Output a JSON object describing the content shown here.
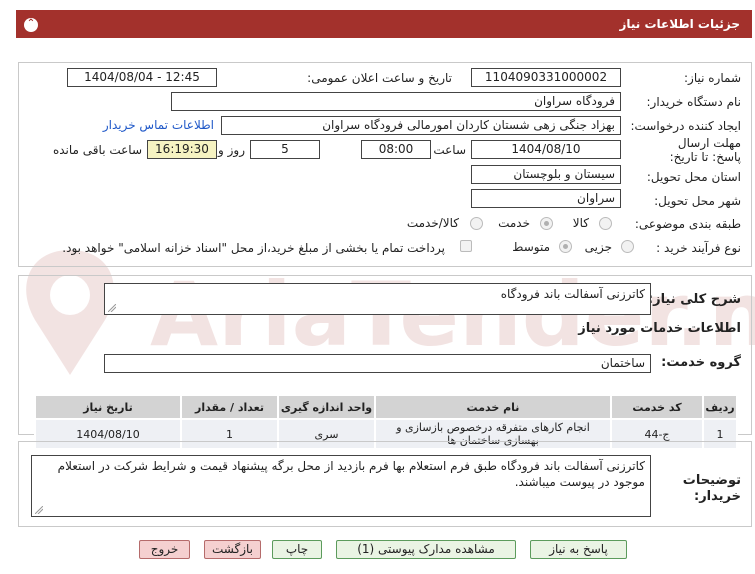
{
  "header": {
    "title": "جزئیات اطلاعات نیاز"
  },
  "labels": {
    "need_number": "شماره نیاز:",
    "public_announce": "تاریخ و ساعت اعلان عمومی:",
    "buyer_org": "نام دستگاه خریدار:",
    "request_creator": "ایجاد کننده درخواست:",
    "deadline": "مهلت ارسال پاسخ: تا تاریخ:",
    "time_word": "ساعت",
    "day_and": "روز و",
    "remaining": "ساعت باقی مانده",
    "province": "استان محل تحویل:",
    "city": "شهر محل تحویل:",
    "category": "طبقه بندی موضوعی:",
    "process_type": "نوع فرآیند خرید :",
    "need_summary": "شرح کلی نیاز:",
    "services_info": "اطلاعات خدمات مورد نیاز",
    "service_group": "گروه خدمت:",
    "buyer_notes": "توضیحات خریدار:"
  },
  "values": {
    "need_number": "1104090331000002",
    "public_announce": "1404/08/04 - 12:45",
    "buyer_org": "فرودگاه سراوان",
    "request_creator": "بهزاد جنگی زهی شستان کاردان امورمالی فرودگاه سراوان",
    "contact_link": "اطلاعات تماس خریدار",
    "deadline_date": "1404/08/10",
    "deadline_time": "08:00",
    "days": "5",
    "remaining_time": "16:19:30",
    "province": "سیستان و بلوچستان",
    "city": "سراوان",
    "need_summary": "کاترزنی آسفالت باند فرودگاه",
    "service_group": "ساختمان",
    "buyer_notes": "کاترزنی آسفالت باند فرودگاه طبق فرم استعلام بها فرم بازدید از محل برگه پیشنهاد قیمت و شرایط شرکت در استعلام موجود در پیوست میباشند."
  },
  "category_options": [
    {
      "label": "کالا",
      "checked": false
    },
    {
      "label": "خدمت",
      "checked": true
    },
    {
      "label": "کالا/خدمت",
      "checked": false
    }
  ],
  "process_options": [
    {
      "label": "جزیی",
      "checked": false
    },
    {
      "label": "متوسط",
      "checked": true
    }
  ],
  "payment_note": "پرداخت تمام یا بخشی از مبلغ خرید،از محل \"اسناد خزانه اسلامی\" خواهد بود.",
  "table": {
    "headers": [
      "ردیف",
      "کد خدمت",
      "نام خدمت",
      "واحد اندازه گیری",
      "تعداد / مقدار",
      "تاریخ نیاز"
    ],
    "rows": [
      [
        "1",
        "ج-44",
        "انجام کارهای متفرقه درخصوص بازسازی و بهسازی ساختمان ها",
        "سری",
        "1",
        "1404/08/10"
      ]
    ]
  },
  "buttons": {
    "reply": "پاسخ به نیاز",
    "attachments": "مشاهده مدارک پیوستی (1)",
    "print": "چاپ",
    "back": "بازگشت",
    "exit": "خروج"
  },
  "watermark": {
    "text": "AriaTender.net"
  },
  "colors": {
    "header": "#a3312c",
    "link": "#1f58c8",
    "button_bg": "#eaf4e4",
    "button_border": "#5c9b5c",
    "button_pink": "#f5d0d0"
  }
}
